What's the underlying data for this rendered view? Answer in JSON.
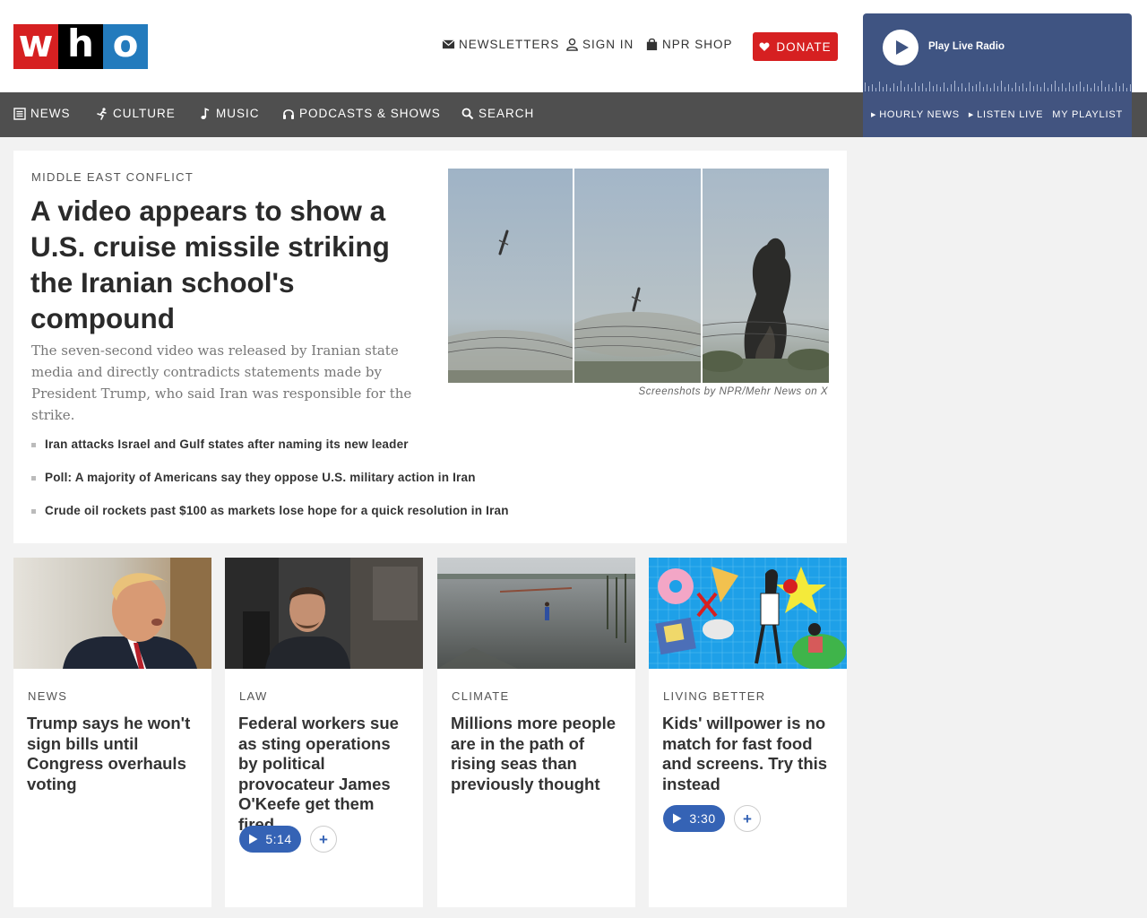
{
  "header": {
    "logo": [
      "w",
      "h",
      "o"
    ],
    "utility": {
      "newsletters": "NEWSLETTERS",
      "sign_in": "SIGN IN",
      "shop": "NPR SHOP"
    },
    "donate_label": "DONATE"
  },
  "live_radio": {
    "label": "Play Live Radio",
    "links": [
      "HOURLY NEWS",
      "LISTEN LIVE",
      "MY PLAYLIST"
    ]
  },
  "nav": {
    "items": [
      {
        "label": "NEWS",
        "icon": "news-icon"
      },
      {
        "label": "CULTURE",
        "icon": "culture-icon"
      },
      {
        "label": "MUSIC",
        "icon": "music-icon"
      },
      {
        "label": "PODCASTS & SHOWS",
        "icon": "headphones-icon"
      },
      {
        "label": "SEARCH",
        "icon": "search-icon"
      }
    ]
  },
  "lead": {
    "kicker": "MIDDLE EAST CONFLICT",
    "headline": "A video appears to show a U.S. cruise missile striking the Iranian school's compound",
    "teaser": "The seven-second video was released by Iranian state media and directly contradicts statements made by President Trump, who said Iran was responsible for the strike.",
    "photo_credit": "Screenshots by NPR/Mehr News on X",
    "related": [
      "Iran attacks Israel and Gulf states after naming its new leader",
      "Poll: A majority of Americans say they oppose U.S. military action in Iran",
      "Crude oil rockets past $100 as markets lose hope for a quick resolution in Iran"
    ]
  },
  "cards": [
    {
      "kicker": "NEWS",
      "headline": "Trump says he won't sign bills until Congress overhauls voting"
    },
    {
      "kicker": "LAW",
      "headline": "Federal workers sue as sting operations by political provocateur James O'Keefe get them fired",
      "duration": "5:14"
    },
    {
      "kicker": "CLIMATE",
      "headline": "Millions more people are in the path of rising seas than previously thought"
    },
    {
      "kicker": "LIVING BETTER",
      "headline": "Kids' willpower is no match for fast food and screens. Try this instead",
      "duration": "3:30"
    }
  ],
  "colors": {
    "brand_red": "#d62021",
    "brand_blue": "#237bbd",
    "nav_bg": "#4f4f4f",
    "radio_bg": "#3f5482",
    "audio_blue": "#3563b5"
  }
}
